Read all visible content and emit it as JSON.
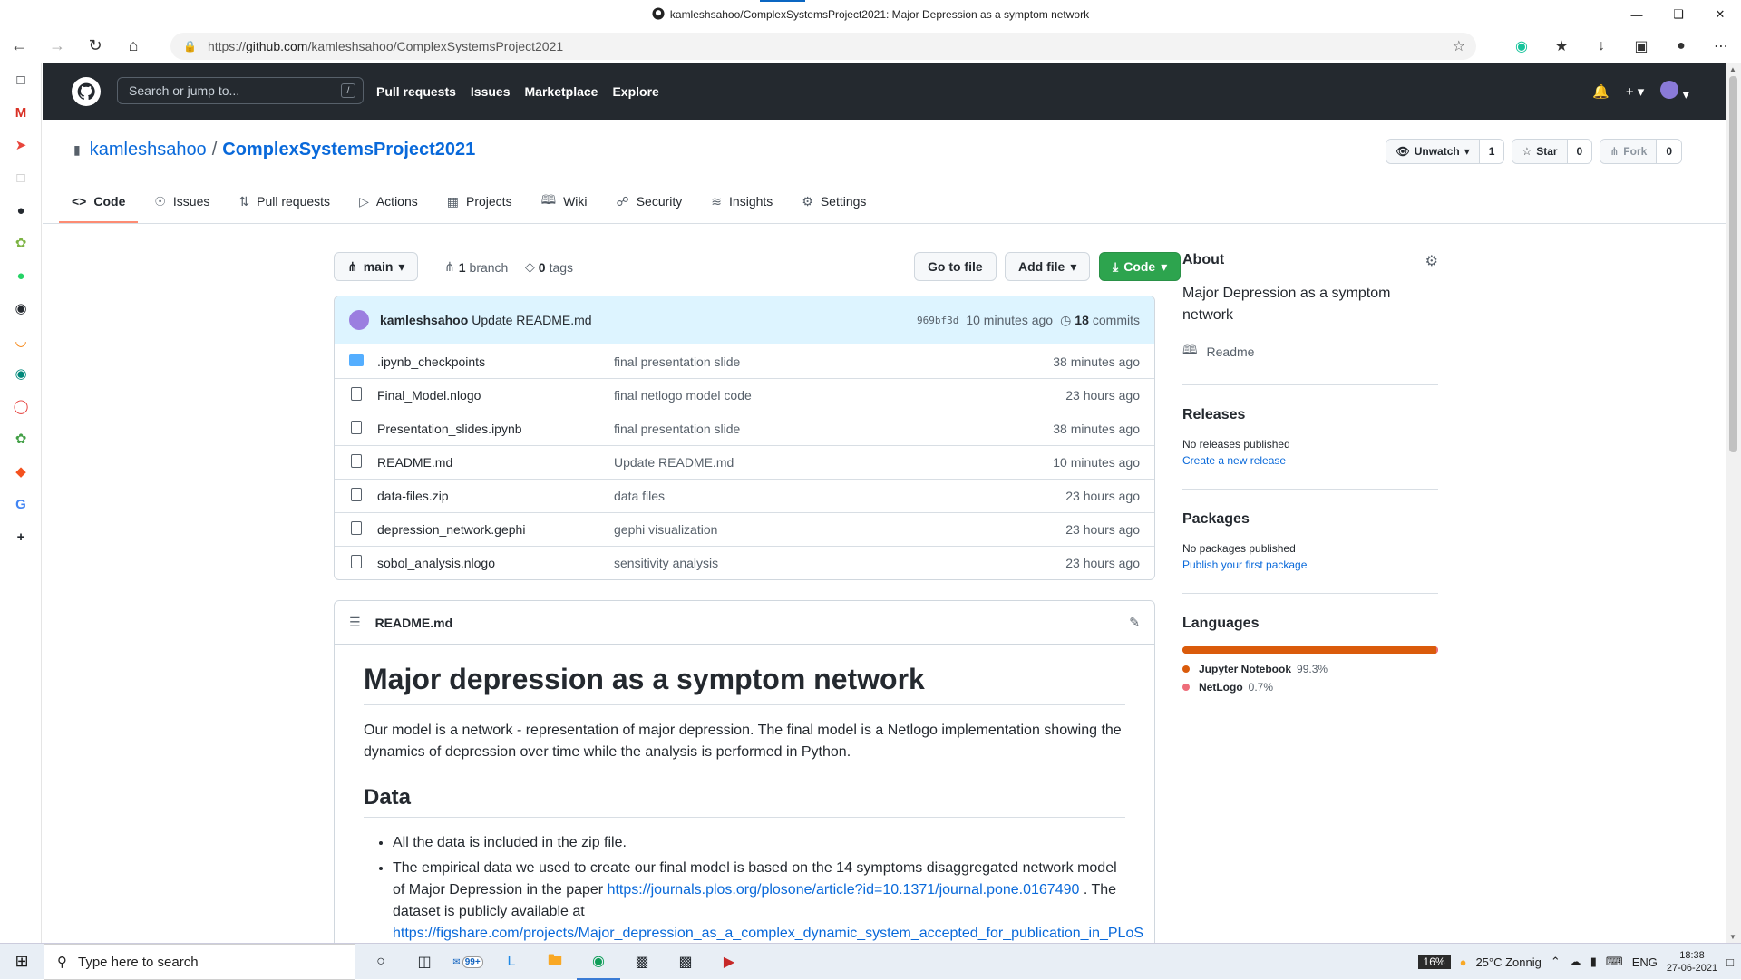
{
  "window": {
    "title": "kamleshsahoo/ComplexSystemsProject2021: Major Depression as a symptom network",
    "url_prefix": "https://",
    "url_host": "github.com",
    "url_path": "/kamleshsahoo/ComplexSystemsProject2021"
  },
  "header": {
    "search_placeholder": "Search or jump to...",
    "slash": "/",
    "nav": [
      "Pull requests",
      "Issues",
      "Marketplace",
      "Explore"
    ]
  },
  "repo": {
    "owner": "kamleshsahoo",
    "separator": "/",
    "name": "ComplexSystemsProject2021",
    "watch_label": "Unwatch",
    "watch_count": "1",
    "star_label": "Star",
    "star_count": "0",
    "fork_label": "Fork",
    "fork_count": "0"
  },
  "tabs": [
    {
      "label": "Code",
      "icon": "code-icon"
    },
    {
      "label": "Issues",
      "icon": "issue-icon"
    },
    {
      "label": "Pull requests",
      "icon": "pull-request-icon"
    },
    {
      "label": "Actions",
      "icon": "play-icon"
    },
    {
      "label": "Projects",
      "icon": "project-icon"
    },
    {
      "label": "Wiki",
      "icon": "book-icon"
    },
    {
      "label": "Security",
      "icon": "shield-icon"
    },
    {
      "label": "Insights",
      "icon": "graph-icon"
    },
    {
      "label": "Settings",
      "icon": "gear-icon"
    }
  ],
  "toolbar": {
    "branch": "main",
    "branch_count": "1",
    "branch_label": "branch",
    "tag_count": "0",
    "tag_label": "tags",
    "go_to_file": "Go to file",
    "add_file": "Add file",
    "code": "Code"
  },
  "commit": {
    "author": "kamleshsahoo",
    "message": "Update README.md",
    "sha": "969bf3d",
    "time": "10 minutes ago",
    "count": "18",
    "count_label": "commits"
  },
  "files": [
    {
      "type": "folder",
      "name": ".ipynb_checkpoints",
      "message": "final presentation slide",
      "age": "38 minutes ago"
    },
    {
      "type": "file",
      "name": "Final_Model.nlogo",
      "message": "final netlogo model code",
      "age": "23 hours ago"
    },
    {
      "type": "file",
      "name": "Presentation_slides.ipynb",
      "message": "final presentation slide",
      "age": "38 minutes ago"
    },
    {
      "type": "file",
      "name": "README.md",
      "message": "Update README.md",
      "age": "10 minutes ago"
    },
    {
      "type": "file",
      "name": "data-files.zip",
      "message": "data files",
      "age": "23 hours ago"
    },
    {
      "type": "file",
      "name": "depression_network.gephi",
      "message": "gephi visualization",
      "age": "23 hours ago"
    },
    {
      "type": "file",
      "name": "sobol_analysis.nlogo",
      "message": "sensitivity analysis",
      "age": "23 hours ago"
    }
  ],
  "readme": {
    "filename": "README.md",
    "h1": "Major depression as a symptom network",
    "intro": "Our model is a network - representation of major depression. The final model is a Netlogo implementation showing the dynamics of depression over time while the analysis is performed in Python.",
    "h2": "Data",
    "bullet1": "All the data is included in the zip file.",
    "bullet2_a": "The empirical data we used to create our final model is based on the 14 symptoms disaggregated network model of Major Depression in the paper ",
    "bullet2_link": "https://journals.plos.org/plosone/article?id=10.1371/journal.pone.0167490",
    "bullet2_b": " . The dataset is publicly available at ",
    "bullet2_link2": "https://figshare.com/projects/Major_depression_as_a_complex_dynamic_system_accepted_for_publication_in_PLoS"
  },
  "about": {
    "title": "About",
    "description": "Major Depression as a symptom network",
    "readme": "Readme"
  },
  "releases": {
    "title": "Releases",
    "none": "No releases published",
    "create": "Create a new release"
  },
  "packages": {
    "title": "Packages",
    "none": "No packages published",
    "publish": "Publish your first package"
  },
  "languages": {
    "title": "Languages",
    "items": [
      {
        "name": "Jupyter Notebook",
        "percent": "99.3%",
        "color": "#DA5B0B",
        "value": 99.3
      },
      {
        "name": "NetLogo",
        "percent": "0.7%",
        "color": "#ee6d7a",
        "value": 0.7
      }
    ]
  },
  "taskbar": {
    "search": "Type here to search",
    "badge": "99+",
    "cpu": "16%",
    "weather": "25°C  Zonnig",
    "lang": "ENG",
    "time": "18:38",
    "date": "27-06-2021"
  }
}
